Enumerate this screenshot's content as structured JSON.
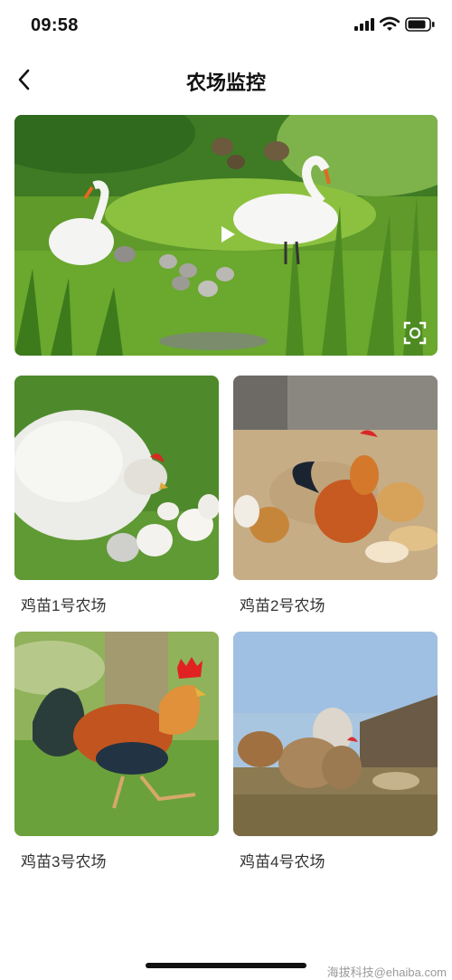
{
  "status_bar": {
    "time": "09:58"
  },
  "header": {
    "title": "农场监控"
  },
  "cards": [
    {
      "label": "鸡苗1号农场"
    },
    {
      "label": "鸡苗2号农场"
    },
    {
      "label": "鸡苗3号农场"
    },
    {
      "label": "鸡苗4号农场"
    }
  ],
  "watermark": "海拔科技@ehaiba.com",
  "icons": {
    "back": "chevron-left-icon",
    "play": "play-icon",
    "scan": "scan-icon",
    "signal": "signal-icon",
    "wifi": "wifi-icon",
    "battery": "battery-icon"
  }
}
